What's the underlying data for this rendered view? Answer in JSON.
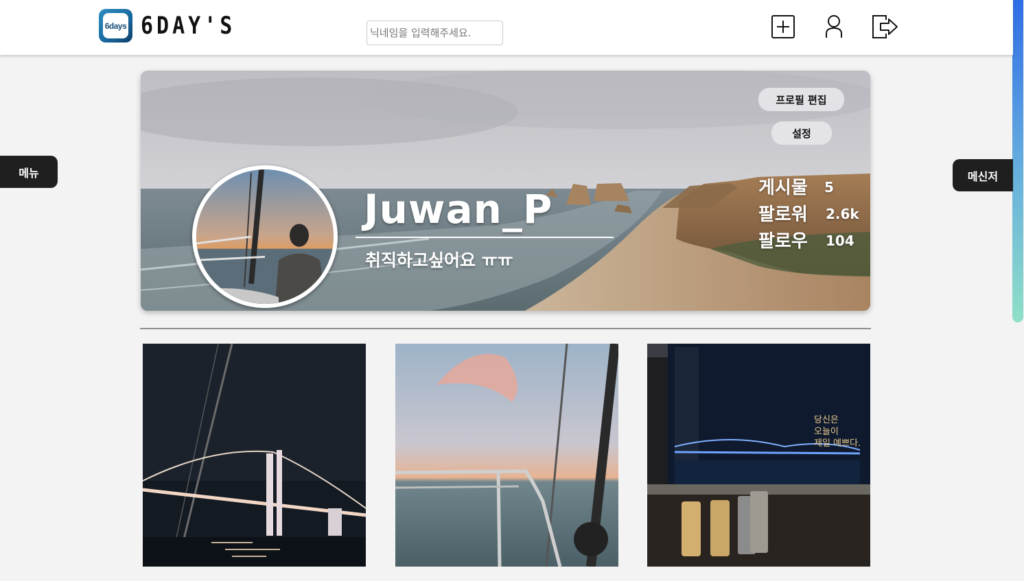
{
  "header": {
    "logo_badge_text": "6days",
    "logo_text": "6DAY'S",
    "search_placeholder": "닉네임을 입력해주세요.",
    "icons": [
      "add-post-icon",
      "user-icon",
      "logout-icon"
    ]
  },
  "side": {
    "menu_label": "메뉴",
    "messenger_label": "메신저"
  },
  "profile": {
    "edit_label": "프로필 편집",
    "settings_label": "설정",
    "username": "Juwan_P",
    "bio": "취직하고싶어요 ㅠㅠ",
    "stats": [
      {
        "label": "게시물",
        "value": "5"
      },
      {
        "label": "팔로워",
        "value": "2.6k"
      },
      {
        "label": "팔로우",
        "value": "104"
      }
    ]
  },
  "posts": [
    {
      "name": "night-bridge-photo"
    },
    {
      "name": "sailing-sunset-photo"
    },
    {
      "name": "window-night-view-photo",
      "overlay_text": "당신은\n오늘이\n제일 예쁘다."
    }
  ],
  "colors": {
    "header_bg": "#ffffff",
    "page_bg": "#f3f3f3",
    "side_tab_bg": "#1f1f1f",
    "scroll_gradient": [
      "#2f6ee6",
      "#8fe0c8"
    ]
  }
}
